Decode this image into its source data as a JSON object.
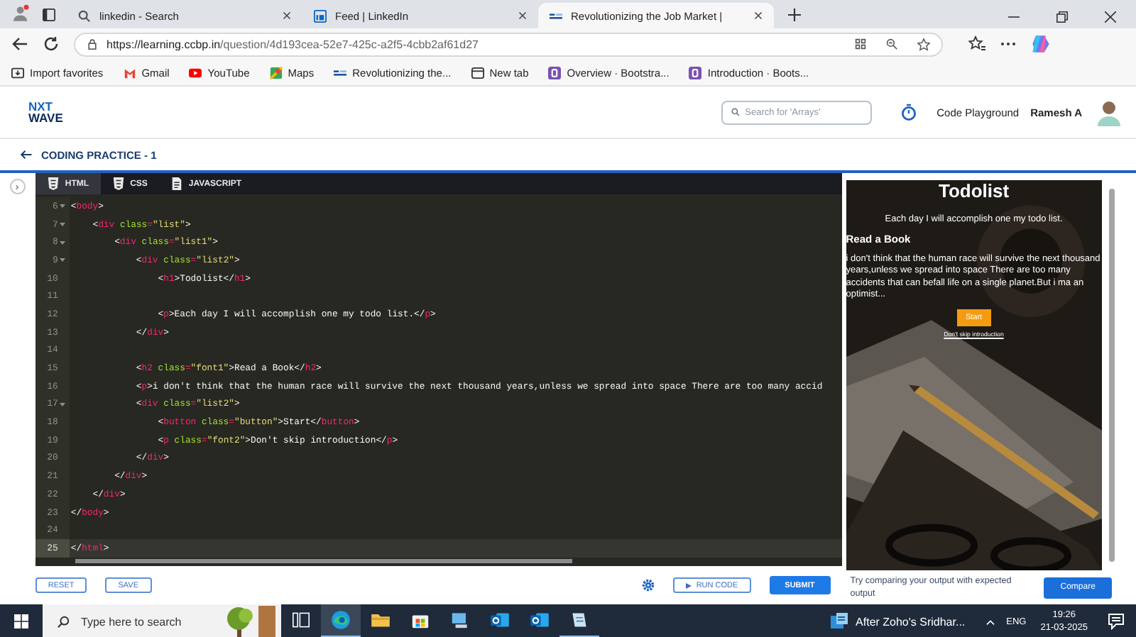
{
  "browser": {
    "tabs": [
      {
        "title": "linkedin - Search",
        "selected": false
      },
      {
        "title": "Feed | LinkedIn",
        "selected": false
      },
      {
        "title": "Revolutionizing the Job Market |",
        "selected": true
      }
    ],
    "url_host": "https://learning.ccbp.in",
    "url_path": "/question/4d193cea-52e7-425c-a2f5-4cbb2af61d27",
    "bookmarks": [
      "Import favorites",
      "Gmail",
      "YouTube",
      "Maps",
      "Revolutionizing the...",
      "New tab",
      "Overview · Bootstra...",
      "Introduction · Boots..."
    ]
  },
  "header": {
    "logo_top": "NXT",
    "logo_bottom": "WAVE",
    "search_placeholder": "Search for 'Arrays'",
    "playground": "Code Playground",
    "user": "Ramesh A"
  },
  "practice": {
    "title": "CODING PRACTICE - 1"
  },
  "editor": {
    "tabs": [
      {
        "label": "HTML",
        "selected": true
      },
      {
        "label": "CSS",
        "selected": false
      },
      {
        "label": "JAVASCRIPT",
        "selected": false
      }
    ],
    "lines": [
      {
        "n": "6",
        "fold": true,
        "active": false,
        "tokens": [
          {
            "kind": "punct",
            "text": "<"
          },
          {
            "kind": "tag",
            "text": "body"
          },
          {
            "kind": "punct",
            "text": ">"
          }
        ]
      },
      {
        "n": "7",
        "fold": true,
        "active": false,
        "tokens": [
          {
            "kind": "punct",
            "text": "    <"
          },
          {
            "kind": "tag",
            "text": "div"
          },
          {
            "kind": "attr",
            "text": " class"
          },
          {
            "kind": "op",
            "text": "="
          },
          {
            "kind": "string",
            "text": "\"list\""
          },
          {
            "kind": "punct",
            "text": ">"
          }
        ]
      },
      {
        "n": "8",
        "fold": true,
        "active": false,
        "tokens": [
          {
            "kind": "punct",
            "text": "        <"
          },
          {
            "kind": "tag",
            "text": "div"
          },
          {
            "kind": "attr",
            "text": " class"
          },
          {
            "kind": "op",
            "text": "="
          },
          {
            "kind": "string",
            "text": "\"list1\""
          },
          {
            "kind": "punct",
            "text": ">"
          }
        ]
      },
      {
        "n": "9",
        "fold": true,
        "active": false,
        "tokens": [
          {
            "kind": "punct",
            "text": "            <"
          },
          {
            "kind": "tag",
            "text": "div"
          },
          {
            "kind": "attr",
            "text": " class"
          },
          {
            "kind": "op",
            "text": "="
          },
          {
            "kind": "string",
            "text": "\"list2\""
          },
          {
            "kind": "punct",
            "text": ">"
          }
        ]
      },
      {
        "n": "10",
        "fold": false,
        "active": false,
        "tokens": [
          {
            "kind": "punct",
            "text": "                <"
          },
          {
            "kind": "tag",
            "text": "h1"
          },
          {
            "kind": "punct",
            "text": ">Todolist</"
          },
          {
            "kind": "tag",
            "text": "h1"
          },
          {
            "kind": "punct",
            "text": ">"
          }
        ]
      },
      {
        "n": "11",
        "fold": false,
        "active": false
      },
      {
        "n": "12",
        "fold": false,
        "active": false,
        "tokens": [
          {
            "kind": "punct",
            "text": "                <"
          },
          {
            "kind": "tag",
            "text": "p"
          },
          {
            "kind": "punct",
            "text": ">Each day I will accomplish one my todo list.</"
          },
          {
            "kind": "tag",
            "text": "p"
          },
          {
            "kind": "punct",
            "text": ">"
          }
        ]
      },
      {
        "n": "13",
        "fold": false,
        "active": false,
        "tokens": [
          {
            "kind": "punct",
            "text": "            </"
          },
          {
            "kind": "tag",
            "text": "div"
          },
          {
            "kind": "punct",
            "text": ">"
          }
        ]
      },
      {
        "n": "14",
        "fold": false,
        "active": false
      },
      {
        "n": "15",
        "fold": false,
        "active": false,
        "tokens": [
          {
            "kind": "punct",
            "text": "            <"
          },
          {
            "kind": "tag",
            "text": "h2"
          },
          {
            "kind": "attr",
            "text": " class"
          },
          {
            "kind": "op",
            "text": "="
          },
          {
            "kind": "string",
            "text": "\"font1\""
          },
          {
            "kind": "punct",
            "text": ">Read a Book</"
          },
          {
            "kind": "tag",
            "text": "h2"
          },
          {
            "kind": "punct",
            "text": ">"
          }
        ]
      },
      {
        "n": "16",
        "fold": false,
        "active": false,
        "tokens": [
          {
            "kind": "punct",
            "text": "            <"
          },
          {
            "kind": "tag",
            "text": "p"
          },
          {
            "kind": "punct",
            "text": ">i don't think that the human race will survive the next thousand years,unless we spread into space There are too many accid"
          }
        ]
      },
      {
        "n": "17",
        "fold": true,
        "active": false,
        "tokens": [
          {
            "kind": "punct",
            "text": "            <"
          },
          {
            "kind": "tag",
            "text": "div"
          },
          {
            "kind": "attr",
            "text": " class"
          },
          {
            "kind": "op",
            "text": "="
          },
          {
            "kind": "string",
            "text": "\"list2\""
          },
          {
            "kind": "punct",
            "text": ">"
          }
        ]
      },
      {
        "n": "18",
        "fold": false,
        "active": false,
        "tokens": [
          {
            "kind": "punct",
            "text": "                <"
          },
          {
            "kind": "tag",
            "text": "button"
          },
          {
            "kind": "attr",
            "text": " class"
          },
          {
            "kind": "op",
            "text": "="
          },
          {
            "kind": "string",
            "text": "\"button\""
          },
          {
            "kind": "punct",
            "text": ">Start</"
          },
          {
            "kind": "tag",
            "text": "button"
          },
          {
            "kind": "punct",
            "text": ">"
          }
        ]
      },
      {
        "n": "19",
        "fold": false,
        "active": false,
        "tokens": [
          {
            "kind": "punct",
            "text": "                <"
          },
          {
            "kind": "tag",
            "text": "p"
          },
          {
            "kind": "attr",
            "text": " class"
          },
          {
            "kind": "op",
            "text": "="
          },
          {
            "kind": "string",
            "text": "\"font2\""
          },
          {
            "kind": "punct",
            "text": ">Don't skip introduction</"
          },
          {
            "kind": "tag",
            "text": "p"
          },
          {
            "kind": "punct",
            "text": ">"
          }
        ]
      },
      {
        "n": "20",
        "fold": false,
        "active": false,
        "tokens": [
          {
            "kind": "punct",
            "text": "            </"
          },
          {
            "kind": "tag",
            "text": "div"
          },
          {
            "kind": "punct",
            "text": ">"
          }
        ]
      },
      {
        "n": "21",
        "fold": false,
        "active": false,
        "tokens": [
          {
            "kind": "punct",
            "text": "        </"
          },
          {
            "kind": "tag",
            "text": "div"
          },
          {
            "kind": "punct",
            "text": ">"
          }
        ]
      },
      {
        "n": "22",
        "fold": false,
        "active": false,
        "tokens": [
          {
            "kind": "punct",
            "text": "    </"
          },
          {
            "kind": "tag",
            "text": "div"
          },
          {
            "kind": "punct",
            "text": ">"
          }
        ]
      },
      {
        "n": "23",
        "fold": false,
        "active": false,
        "tokens": [
          {
            "kind": "punct",
            "text": "</"
          },
          {
            "kind": "tag",
            "text": "body"
          },
          {
            "kind": "punct",
            "text": ">"
          }
        ]
      },
      {
        "n": "24",
        "fold": false,
        "active": false
      },
      {
        "n": "25",
        "fold": false,
        "active": true,
        "tokens": [
          {
            "kind": "punct",
            "text": "</"
          },
          {
            "kind": "tag",
            "text": "html"
          },
          {
            "kind": "punct",
            "text": ">"
          }
        ]
      }
    ]
  },
  "preview": {
    "title": "Todolist",
    "subtitle": "Each day I will accomplish one my todo list.",
    "heading": "Read a Book",
    "paragraph": "i don't think that the human race will survive the next thousand years,unless we spread into space There are too many accidents that can befall life on a single planet.But i ma an optimist...",
    "button": "Start",
    "link": "Don't skip introduction"
  },
  "actions": {
    "reset": "RESET",
    "save": "SAVE",
    "run": "RUN CODE",
    "submit": "SUBMIT",
    "compare_hint": "Try comparing your output with expected output",
    "compare": "Compare"
  },
  "taskbar": {
    "search_placeholder": "Type here to search",
    "apps": [
      {
        "selected": false,
        "running": false
      },
      {
        "selected": true,
        "running": true
      },
      {
        "selected": false,
        "running": false
      },
      {
        "selected": false,
        "running": false
      },
      {
        "selected": false,
        "running": false
      },
      {
        "selected": false,
        "running": false
      },
      {
        "selected": false,
        "running": false
      },
      {
        "selected": false,
        "running": true
      }
    ],
    "news": "After Zoho's Sridhar...",
    "lang": "ENG",
    "time": "19:26",
    "date": "21-03-2025"
  }
}
